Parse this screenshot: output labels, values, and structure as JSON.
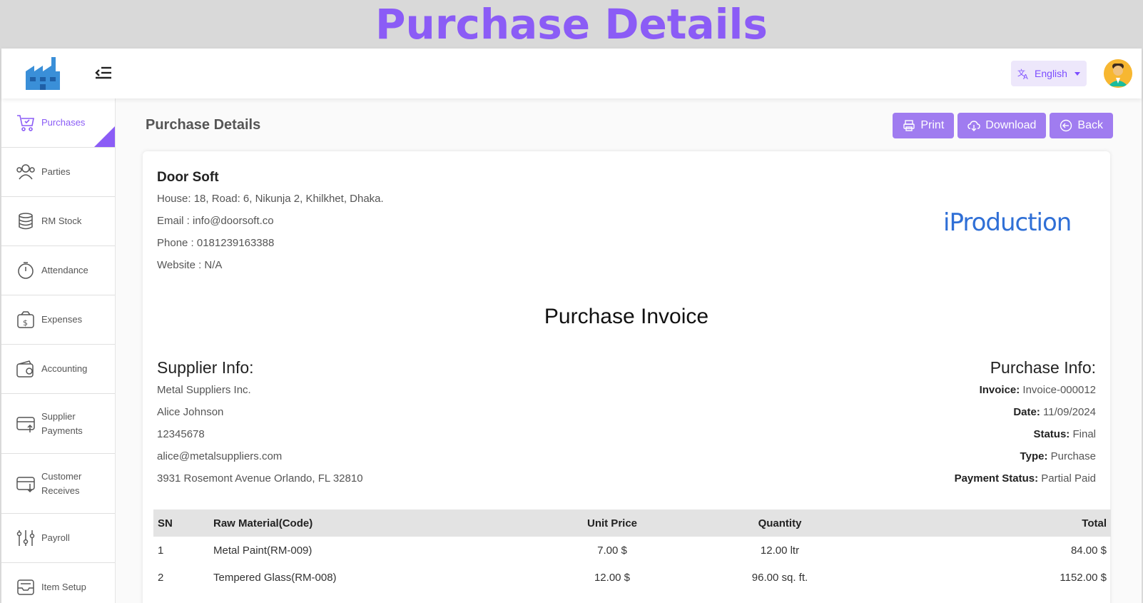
{
  "banner": {
    "title": "Purchase Details"
  },
  "topbar": {
    "language": "English"
  },
  "sidebar": {
    "items": [
      {
        "label": "Purchases",
        "active": true
      },
      {
        "label": "Parties"
      },
      {
        "label": "RM Stock"
      },
      {
        "label": "Attendance"
      },
      {
        "label": "Expenses"
      },
      {
        "label": "Accounting"
      },
      {
        "label": "Supplier Payments"
      },
      {
        "label": "Customer Receives"
      },
      {
        "label": "Payroll"
      },
      {
        "label": "Item Setup"
      }
    ]
  },
  "main": {
    "title": "Purchase Details",
    "actions": {
      "print": "Print",
      "download": "Download",
      "back": "Back"
    },
    "company": {
      "name": "Door Soft",
      "address": "House: 18, Road: 6, Nikunja 2, Khilkhet, Dhaka.",
      "email": "Email : info@doorsoft.co",
      "phone": "Phone : 0181239163388",
      "website": "Website : N/A"
    },
    "brand": "iProduction",
    "invoice_title": "Purchase Invoice",
    "supplier": {
      "heading": "Supplier Info:",
      "company": "Metal Suppliers Inc.",
      "contact": "Alice Johnson",
      "phone": "12345678",
      "email": "alice@metalsuppliers.com",
      "address": "3931 Rosemont Avenue Orlando, FL 32810"
    },
    "purchase": {
      "heading": "Purchase Info:",
      "invoice_label": "Invoice:",
      "invoice": "Invoice-000012",
      "date_label": "Date:",
      "date": "11/09/2024",
      "status_label": "Status:",
      "status": "Final",
      "type_label": "Type:",
      "type": "Purchase",
      "payment_label": "Payment Status:",
      "payment": "Partial Paid"
    },
    "table": {
      "headers": {
        "sn": "SN",
        "material": "Raw Material(Code)",
        "price": "Unit Price",
        "qty": "Quantity",
        "total": "Total"
      },
      "rows": [
        {
          "sn": "1",
          "material": "Metal Paint(RM-009)",
          "price": "7.00 $",
          "qty": "12.00 ltr",
          "total": "84.00 $"
        },
        {
          "sn": "2",
          "material": "Tempered Glass(RM-008)",
          "price": "12.00 $",
          "qty": "96.00 sq. ft.",
          "total": "1152.00 $"
        }
      ]
    }
  }
}
